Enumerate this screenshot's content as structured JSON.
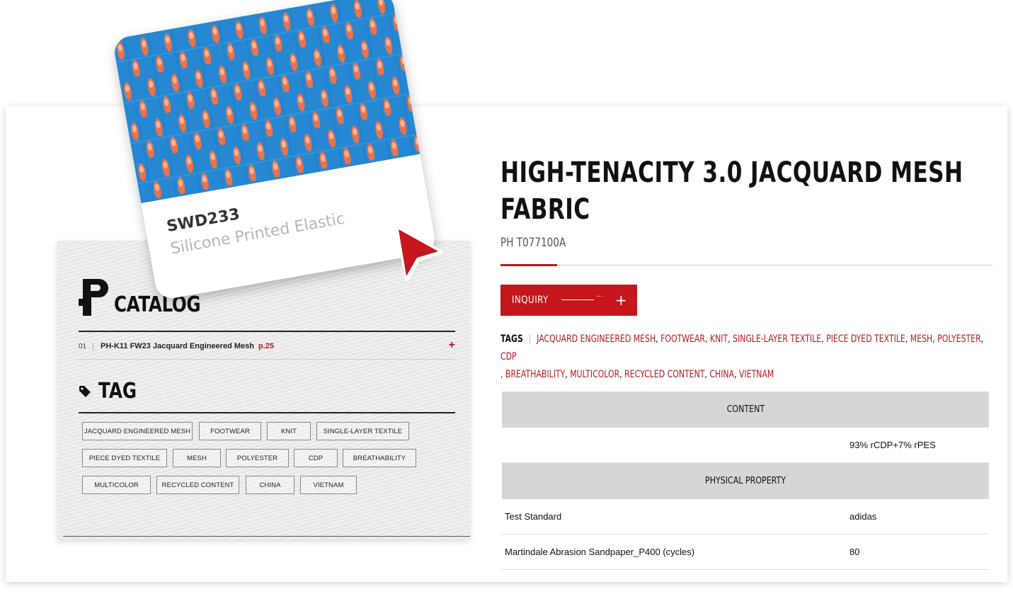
{
  "sample": {
    "code": "SWD233",
    "description": "Silicone Printed Elastic",
    "fabric_colors": {
      "base": "#2a8ed8",
      "accent": "#e9734c",
      "highlight": "#f6b59a"
    }
  },
  "catalog": {
    "title": "CATALOG",
    "items": [
      {
        "number": "01",
        "name": "PH-K11 FW23 Jacquard Engineered Mesh",
        "page": "p.25",
        "expand": "+"
      }
    ]
  },
  "tag_section": {
    "title": "TAG",
    "chips": [
      "JACQUARD ENGINEERED MESH",
      "FOOTWEAR",
      "KNIT",
      "SINGLE-LAYER TEXTILE",
      "PIECE DYED TEXTILE",
      "MESH",
      "POLYESTER",
      "CDP",
      "BREATHABILITY",
      "MULTICOLOR",
      "RECYCLED CONTENT",
      "CHINA",
      "VIETNAM"
    ]
  },
  "product": {
    "title_line1": "HIGH-TENACITY 3.0 JACQUARD MESH",
    "title_line2": "FABRIC",
    "code": "PH T077100A",
    "inquiry_label": "INQUIRY",
    "inquiry_dots": "···",
    "inquiry_plus": "+",
    "tags_label": "TAGS",
    "tags_separator": "|",
    "tags": [
      "JACQUARD ENGINEERED MESH",
      "FOOTWEAR",
      "KNIT",
      "SINGLE-LAYER TEXTILE",
      "PIECE DYED TEXTILE",
      "MESH",
      "POLYESTER",
      "CDP",
      "BREATHABILITY",
      "MULTICOLOR",
      "RECYCLED CONTENT",
      "CHINA",
      "VIETNAM"
    ]
  },
  "specs": {
    "content_header": "CONTENT",
    "content_value": "93% rCDP+7% rPES",
    "physical_header": "PHYSICAL PROPERTY",
    "rows": [
      {
        "key": "Test Standard",
        "value": "adidas"
      },
      {
        "key": "Martindale Abrasion Sandpaper_P400 (cycles)",
        "value": "80"
      }
    ]
  },
  "colors": {
    "accent": "#c4161c",
    "accent_text": "#b3191d",
    "table_header": "#d6d6d6"
  }
}
